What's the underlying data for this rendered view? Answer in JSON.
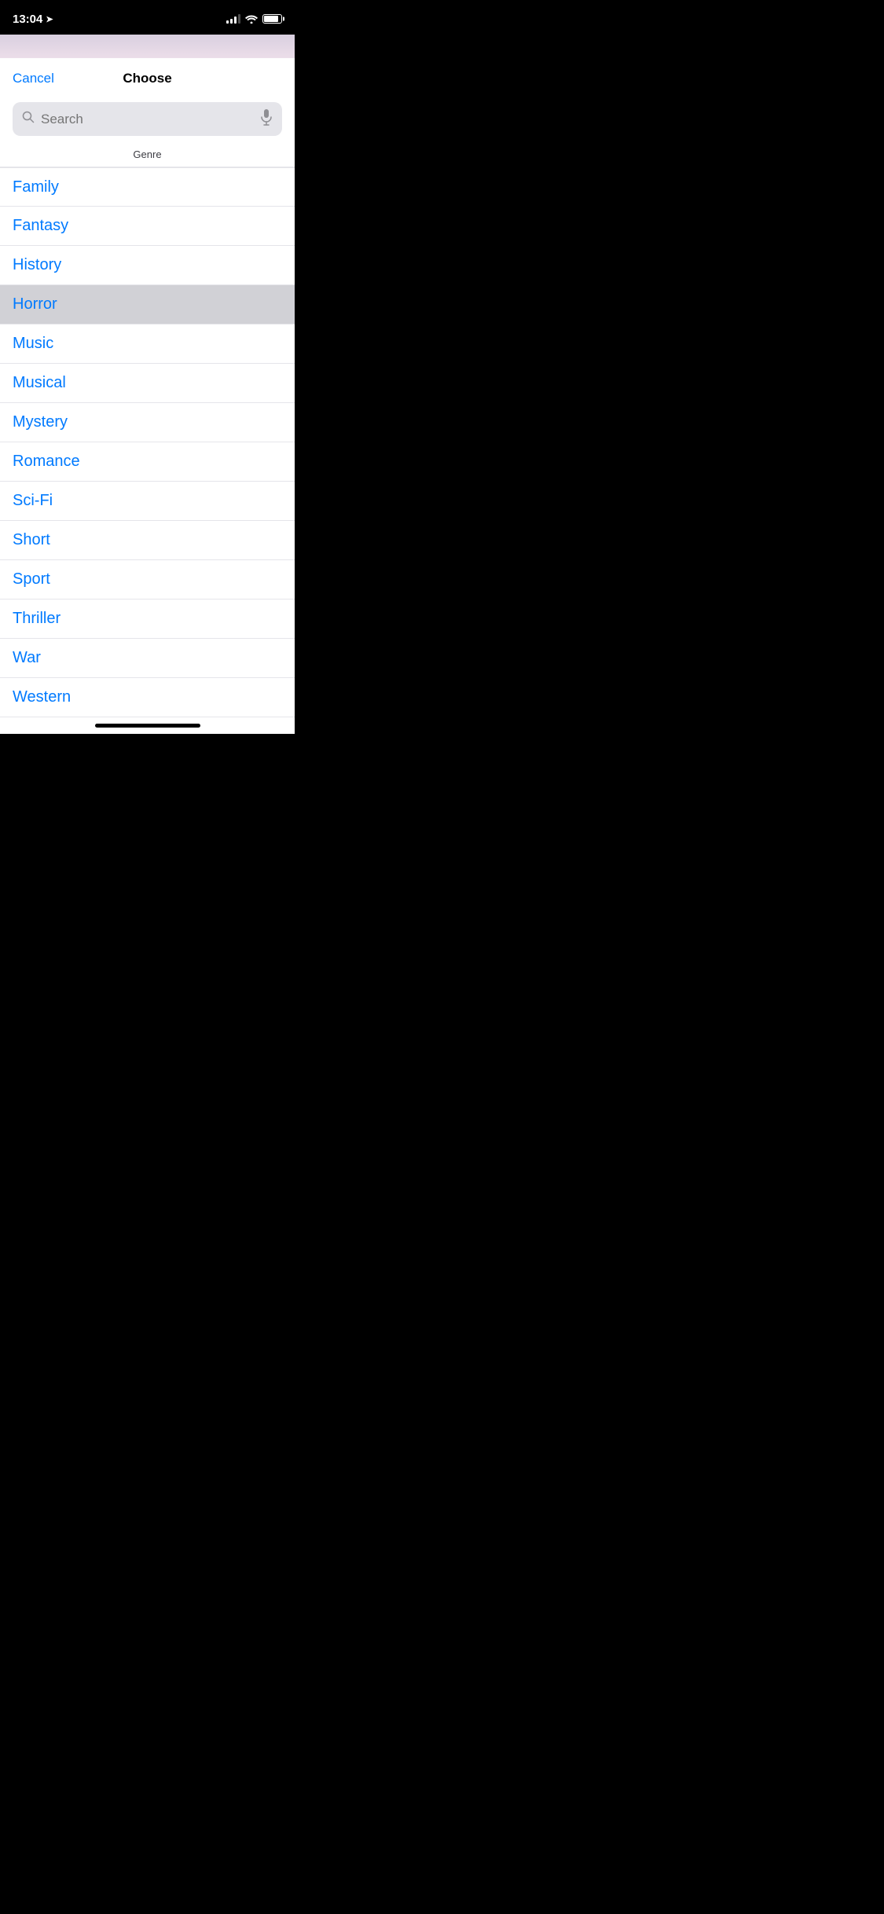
{
  "statusBar": {
    "time": "13:04",
    "locationArrow": "➤"
  },
  "modal": {
    "cancelLabel": "Cancel",
    "title": "Choose",
    "sectionHeader": "Genre",
    "search": {
      "placeholder": "Search"
    },
    "genres": [
      {
        "id": "family",
        "label": "Family",
        "selected": false,
        "partialTop": true
      },
      {
        "id": "fantasy",
        "label": "Fantasy",
        "selected": false
      },
      {
        "id": "history",
        "label": "History",
        "selected": false
      },
      {
        "id": "horror",
        "label": "Horror",
        "selected": true
      },
      {
        "id": "music",
        "label": "Music",
        "selected": false
      },
      {
        "id": "musical",
        "label": "Musical",
        "selected": false
      },
      {
        "id": "mystery",
        "label": "Mystery",
        "selected": false
      },
      {
        "id": "romance",
        "label": "Romance",
        "selected": false
      },
      {
        "id": "sci-fi",
        "label": "Sci-Fi",
        "selected": false
      },
      {
        "id": "short",
        "label": "Short",
        "selected": false
      },
      {
        "id": "sport",
        "label": "Sport",
        "selected": false
      },
      {
        "id": "thriller",
        "label": "Thriller",
        "selected": false
      },
      {
        "id": "war",
        "label": "War",
        "selected": false
      },
      {
        "id": "western",
        "label": "Western",
        "selected": false
      }
    ]
  },
  "colors": {
    "blue": "#007aff",
    "selected_bg": "#d1d1d6",
    "divider": "#e5e5ea",
    "text_secondary": "#8e8e93"
  }
}
